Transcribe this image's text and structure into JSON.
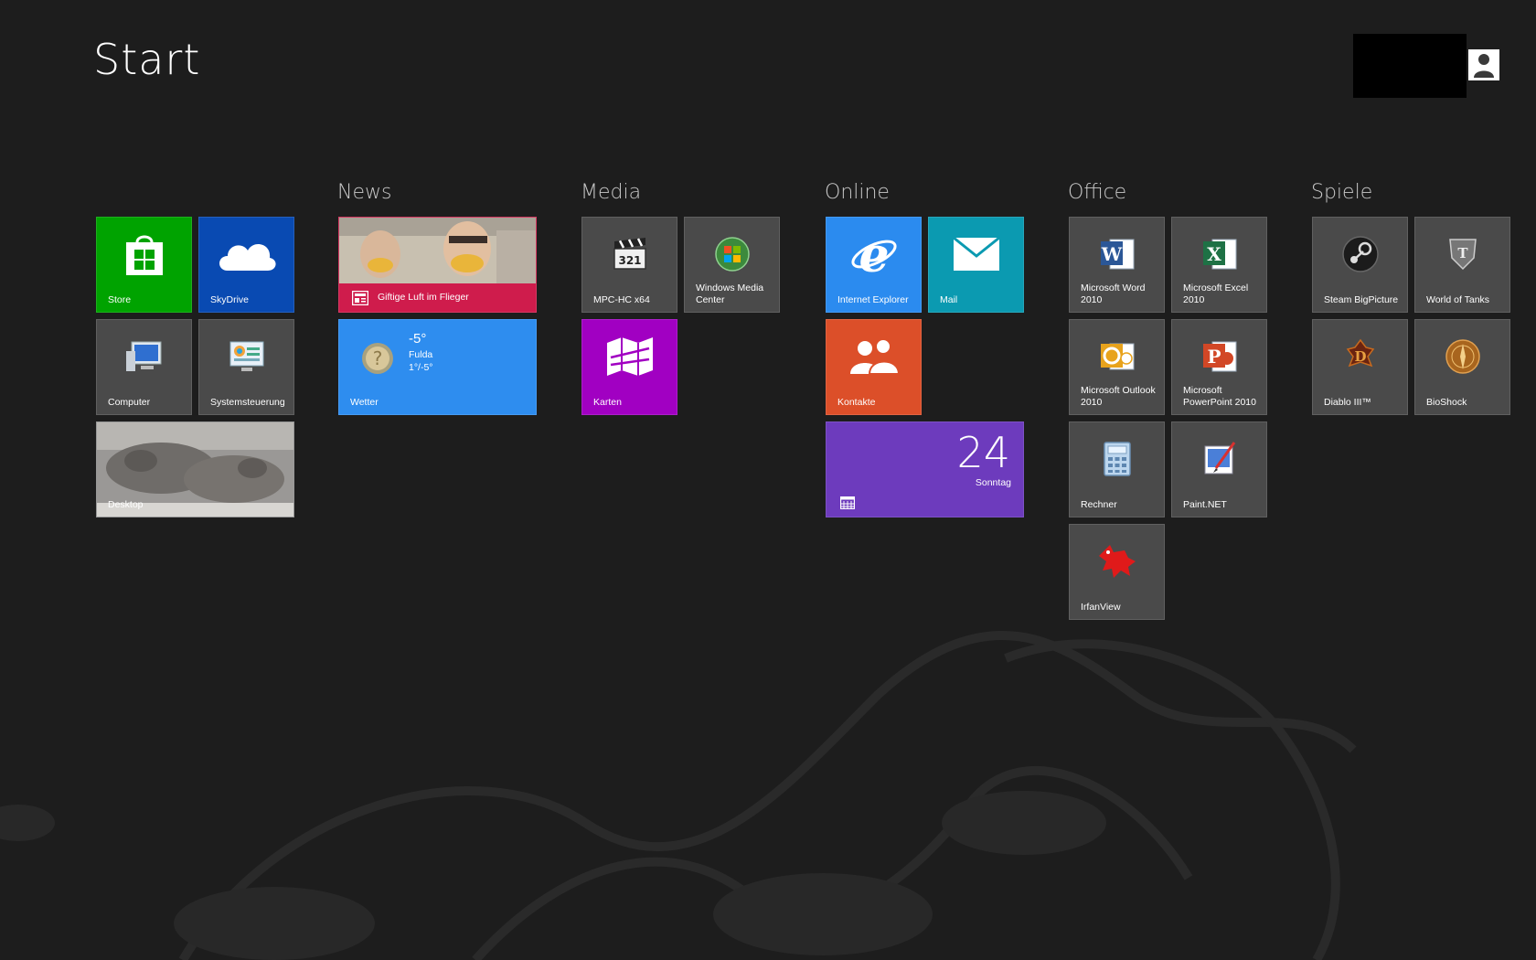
{
  "page": {
    "title": "Start"
  },
  "groups": {
    "news": "News",
    "media": "Media",
    "online": "Online",
    "office": "Office",
    "spiele": "Spiele"
  },
  "tiles": {
    "store": "Store",
    "skydrive": "SkyDrive",
    "computer": "Computer",
    "systemsteuerung": "Systemsteuerung",
    "desktop": "Desktop",
    "news_headline": "Giftige Luft im Flieger",
    "weather": {
      "label": "Wetter",
      "temp": "-5°",
      "city": "Fulda",
      "range": "1°/-5°"
    },
    "mpc": "MPC-HC x64",
    "wmc": "Windows Media Center",
    "karten": "Karten",
    "ie": "Internet Explorer",
    "mail": "Mail",
    "kontakte": "Kontakte",
    "calendar": {
      "day": "24",
      "weekday": "Sonntag"
    },
    "word": "Microsoft Word 2010",
    "excel": "Microsoft Excel 2010",
    "outlook": "Microsoft Outlook 2010",
    "powerpoint": "Microsoft PowerPoint 2010",
    "rechner": "Rechner",
    "paintnet": "Paint.NET",
    "irfanview": "IrfanView",
    "steam": "Steam BigPicture",
    "wot": "World of Tanks",
    "diablo": "Diablo III™",
    "bioshock": "BioShock"
  },
  "colors": {
    "background": "#1d1d1d",
    "store": "#00a300",
    "skydrive": "#094ab2",
    "news": "#d11d4d",
    "weather": "#2e8def",
    "karten": "#a100c2",
    "ie": "#2b8bef",
    "mail": "#0b9ab1",
    "kontakte": "#dc4f29",
    "calendar": "#6d3bbd",
    "app_tile": "#4a4a4a"
  }
}
